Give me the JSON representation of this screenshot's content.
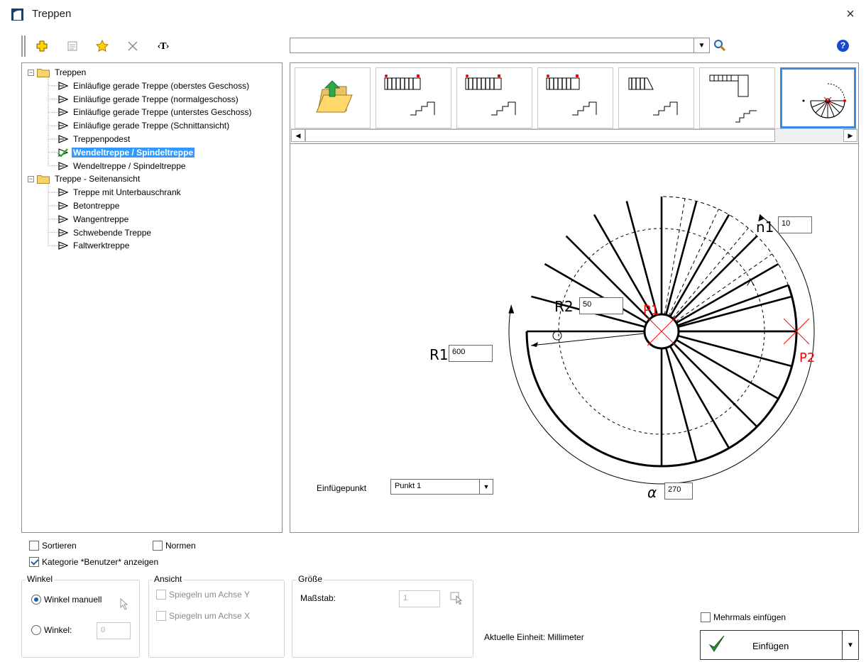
{
  "window": {
    "title": "Treppen",
    "close_glyph": "×"
  },
  "toolbar": {
    "icons": [
      "add-icon",
      "properties-icon",
      "favorite-star-icon",
      "delete-icon",
      "text-placeholder-icon"
    ],
    "text_button": "‹T›"
  },
  "search": {
    "value": "",
    "placeholder": ""
  },
  "help": {
    "glyph": "?"
  },
  "tree": [
    {
      "label": "Treppen",
      "level": 0,
      "type": "folder",
      "expanded": true
    },
    {
      "label": "Einläufige gerade Treppe (oberstes Geschoss)",
      "level": 1,
      "type": "item"
    },
    {
      "label": "Einläufige gerade Treppe (normalgeschoss)",
      "level": 1,
      "type": "item"
    },
    {
      "label": "Einläufige gerade Treppe (unterstes Geschoss)",
      "level": 1,
      "type": "item"
    },
    {
      "label": "Einläufige gerade Treppe (Schnittansicht)",
      "level": 1,
      "type": "item"
    },
    {
      "label": "Treppenpodest",
      "level": 1,
      "type": "item"
    },
    {
      "label": "Wendeltreppe / Spindeltreppe",
      "level": 1,
      "type": "item",
      "selected": true,
      "checked": true
    },
    {
      "label": "Wendeltreppe / Spindeltreppe",
      "level": 1,
      "type": "item"
    },
    {
      "label": "Treppe - Seitenansicht",
      "level": 0,
      "type": "folder",
      "expanded": true
    },
    {
      "label": "Treppe mit Unterbauschrank",
      "level": 1,
      "type": "item"
    },
    {
      "label": "Betontreppe",
      "level": 1,
      "type": "item"
    },
    {
      "label": "Wangentreppe",
      "level": 1,
      "type": "item"
    },
    {
      "label": "Schwebende Treppe",
      "level": 1,
      "type": "item"
    },
    {
      "label": "Faltwerktreppe",
      "level": 1,
      "type": "item"
    }
  ],
  "gallery": {
    "thumbnails": [
      "open-folder-icon",
      "stair-top-floor-thumbnail",
      "stair-normal-floor-thumbnail",
      "stair-bottom-floor-thumbnail",
      "stair-section-thumbnail",
      "landing-thumbnail",
      "spiral-stair-thumbnail"
    ],
    "selected_index": 6
  },
  "preview": {
    "labels": {
      "n1": "n1",
      "r2": "R2",
      "r1": "R1",
      "p1": "P1",
      "p2": "P2",
      "alpha": "α"
    },
    "values": {
      "n1": "10",
      "r2": "50",
      "r1": "600",
      "alpha": "270"
    },
    "insert_point_label": "Einfügepunkt",
    "insert_point_value": "Punkt 1",
    "accent_color": "#ff0000"
  },
  "options": {
    "sort_label": "Sortieren",
    "sort_checked": false,
    "norms_label": "Normen",
    "norms_checked": false,
    "category_label": "Kategorie *Benutzer* anzeigen",
    "category_checked": true
  },
  "angle_group": {
    "title": "Winkel",
    "manual_label": "Winkel manuell",
    "angle_label": "Winkel:",
    "angle_value": "0",
    "manual_selected": true
  },
  "view_group": {
    "title": "Ansicht",
    "mirror_y": "Spiegeln um Achse Y",
    "mirror_x": "Spiegeln um Achse X"
  },
  "size_group": {
    "title": "Größe",
    "scale_label": "Maßstab:",
    "scale_value": "1"
  },
  "unit_text": "Aktuelle Einheit: Millimeter",
  "multi_insert": {
    "label": "Mehrmals einfügen",
    "checked": false
  },
  "insert_button": {
    "label": "Einfügen"
  }
}
